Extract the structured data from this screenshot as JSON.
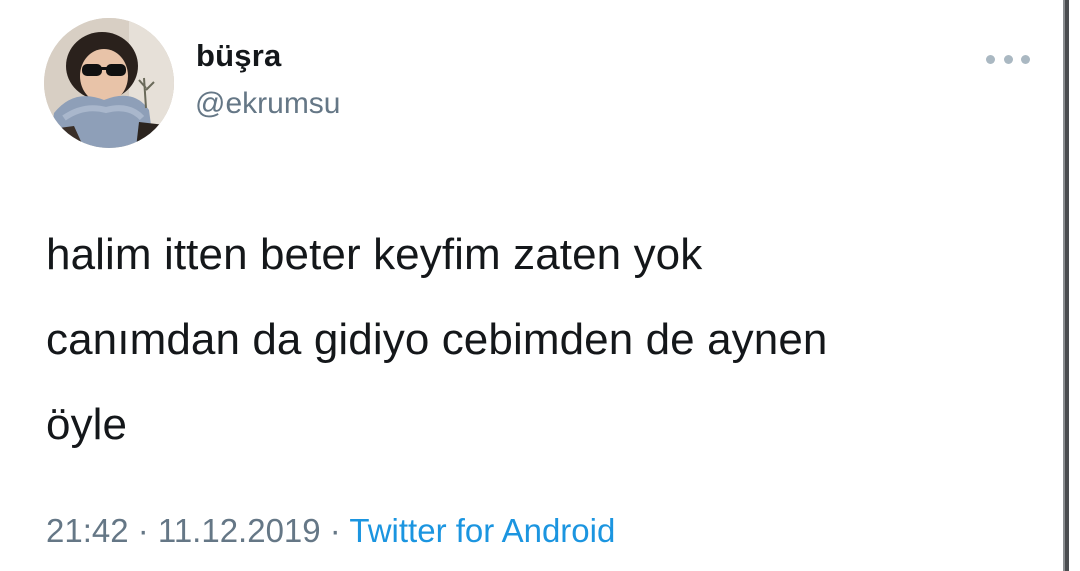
{
  "user": {
    "display_name": "büşra",
    "handle": "@ekrumsu",
    "avatar_icon": "profile-photo"
  },
  "more_icon": "more-horizontal-icon",
  "tweet": {
    "lines": [
      "halim itten beter keyfim zaten yok",
      "canımdan da gidiyo cebimden de aynen",
      "öyle"
    ]
  },
  "meta": {
    "time": "21:42",
    "separator": " · ",
    "date": "11.12.2019",
    "source": "Twitter for Android"
  },
  "colors": {
    "text": "#14171a",
    "secondary": "#657786",
    "link": "#1b95e0",
    "more_dots": "#aab8c2"
  }
}
